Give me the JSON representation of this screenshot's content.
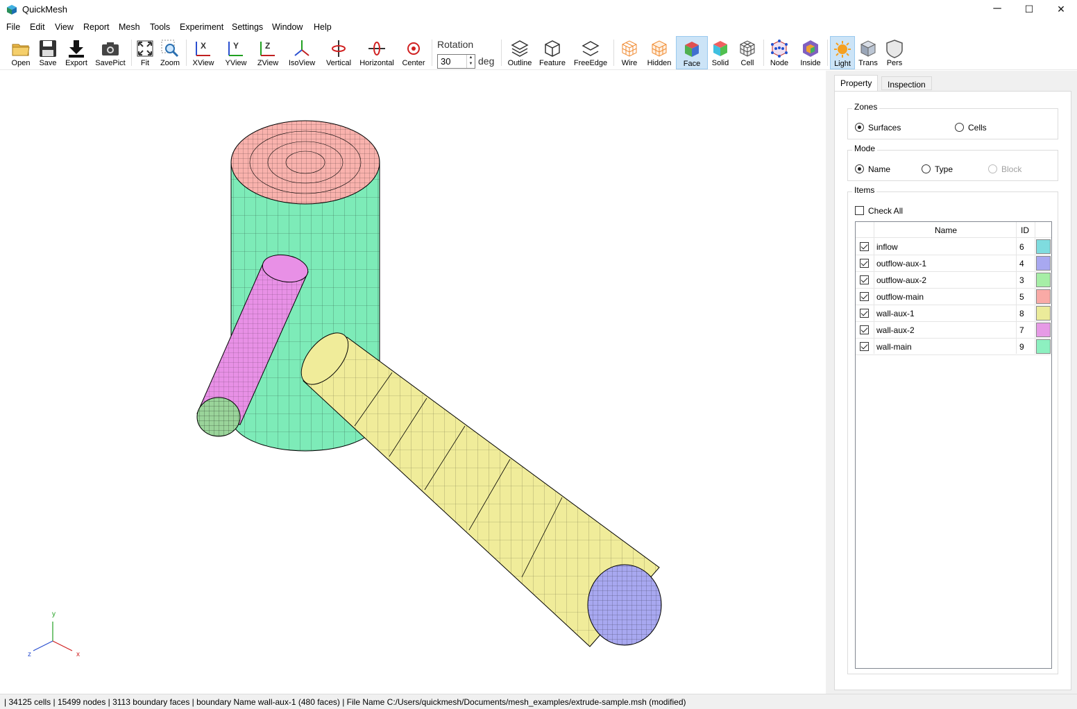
{
  "window": {
    "title": "QuickMesh",
    "minimize": "─",
    "maximize": "☐",
    "close": "✕"
  },
  "menu": [
    "File",
    "Edit",
    "View",
    "Report",
    "Mesh",
    "Tools",
    "Experiment",
    "Settings",
    "Window",
    "Help"
  ],
  "toolbar": {
    "buttons": [
      {
        "label": "Open",
        "icon": "folder-icon"
      },
      {
        "label": "Save",
        "icon": "floppy-icon"
      },
      {
        "label": "Export",
        "icon": "download-icon"
      },
      {
        "label": "SavePict",
        "icon": "camera-icon"
      },
      {
        "label": "Fit",
        "icon": "fit-icon"
      },
      {
        "label": "Zoom",
        "icon": "zoom-icon"
      },
      {
        "label": "XView",
        "icon": "xview-icon"
      },
      {
        "label": "YView",
        "icon": "yview-icon"
      },
      {
        "label": "ZView",
        "icon": "zview-icon"
      },
      {
        "label": "IsoView",
        "icon": "isoview-icon"
      },
      {
        "label": "Vertical",
        "icon": "vertical-rotate-icon"
      },
      {
        "label": "Horizontal",
        "icon": "horizontal-rotate-icon"
      },
      {
        "label": "Center",
        "icon": "center-icon"
      },
      {
        "label": "Outline",
        "icon": "outline-icon"
      },
      {
        "label": "Feature",
        "icon": "feature-icon"
      },
      {
        "label": "FreeEdge",
        "icon": "freeedge-icon"
      },
      {
        "label": "Wire",
        "icon": "wire-icon"
      },
      {
        "label": "Hidden",
        "icon": "hidden-icon"
      },
      {
        "label": "Face",
        "icon": "face-icon"
      },
      {
        "label": "Solid",
        "icon": "solid-icon"
      },
      {
        "label": "Cell",
        "icon": "cell-icon"
      },
      {
        "label": "Node",
        "icon": "node-icon"
      },
      {
        "label": "Inside",
        "icon": "inside-icon"
      },
      {
        "label": "Light",
        "icon": "light-icon"
      },
      {
        "label": "Trans",
        "icon": "trans-icon"
      },
      {
        "label": "Pers",
        "icon": "pers-icon"
      }
    ],
    "rotation_label": "Rotation",
    "rotation_value": "30",
    "rotation_unit": "deg",
    "active": [
      "Face",
      "Light"
    ]
  },
  "viewport": {
    "axis_labels": {
      "x": "x",
      "y": "y",
      "z": "z"
    },
    "colors": {
      "top": "#f9b2ad",
      "body": "#7debb8",
      "aux_small": "#e890e6",
      "aux_small_end": "#9ad49a",
      "aux_large": "#f0ec9a",
      "aux_large_end": "#a8a8f0"
    }
  },
  "panel": {
    "tabs": [
      "Property",
      "Inspection"
    ],
    "zones_title": "Zones",
    "zones_options": [
      "Surfaces",
      "Cells"
    ],
    "mode_title": "Mode",
    "mode_options": [
      "Name",
      "Type",
      "Block"
    ],
    "items_title": "Items",
    "check_all": "Check All",
    "columns": [
      "Name",
      "ID"
    ],
    "items": [
      {
        "name": "inflow",
        "id": "6",
        "color": "#7fdcdf"
      },
      {
        "name": "outflow-aux-1",
        "id": "4",
        "color": "#a8a8f0"
      },
      {
        "name": "outflow-aux-2",
        "id": "3",
        "color": "#a6eea6"
      },
      {
        "name": "outflow-main",
        "id": "5",
        "color": "#f9aaa6"
      },
      {
        "name": "wall-aux-1",
        "id": "8",
        "color": "#ebeb9a"
      },
      {
        "name": "wall-aux-2",
        "id": "7",
        "color": "#e69ae6"
      },
      {
        "name": "wall-main",
        "id": "9",
        "color": "#8df0c0"
      }
    ]
  },
  "status": "| 34125 cells | 15499 nodes | 3113 boundary faces |  boundary Name wall-aux-1 (480 faces) | File Name C:/Users/quickmesh/Documents/mesh_examples/extrude-sample.msh (modified)"
}
